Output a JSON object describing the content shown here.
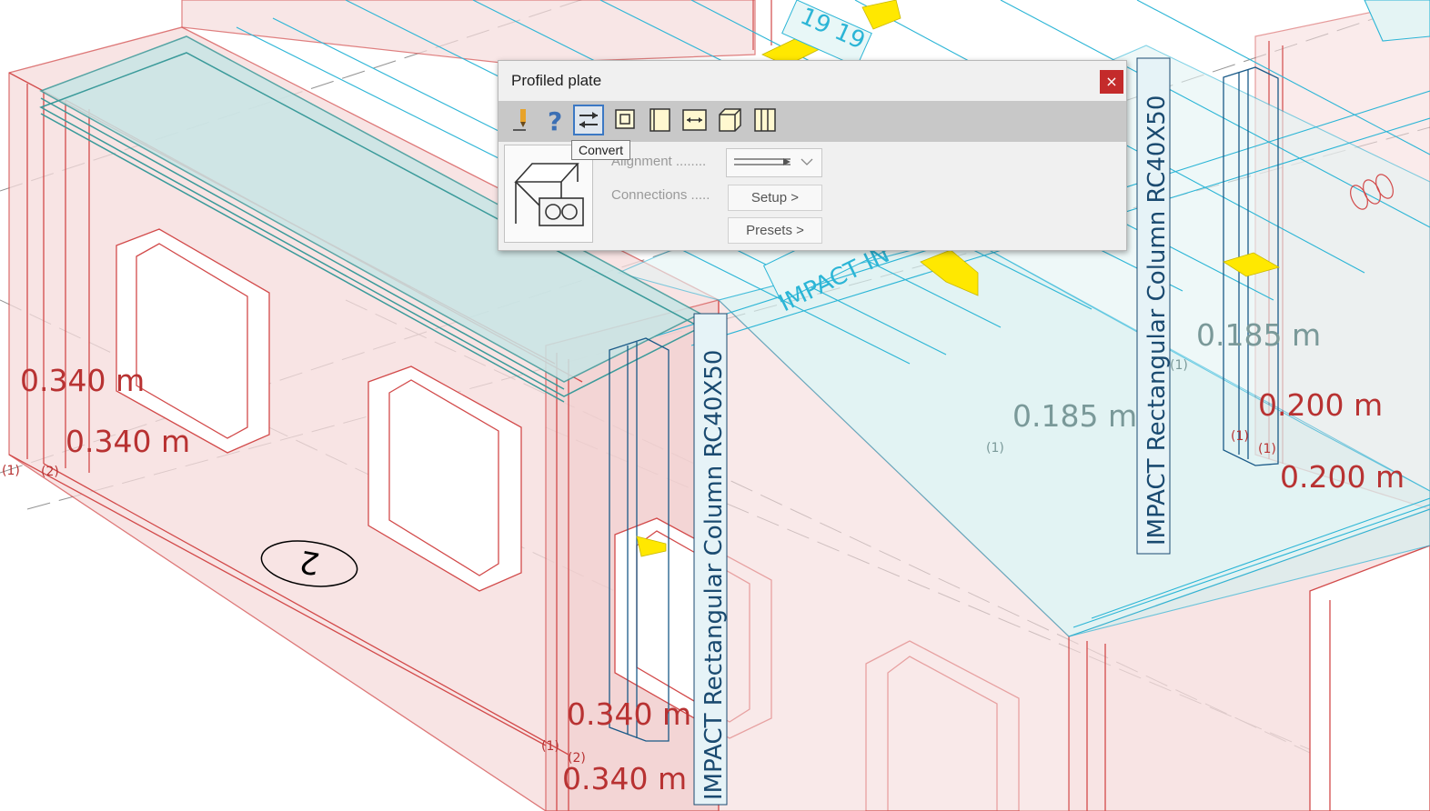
{
  "dialog": {
    "title": "Profiled plate",
    "close_label": "×",
    "tooltip": "Convert",
    "alignment_label": "Alignment ........",
    "connections_label": "Connections .....",
    "setup_button": "Setup >",
    "presets_button": "Presets >",
    "toolbar_icons": [
      "pencil-icon",
      "help-icon",
      "convert-icon",
      "square-frame-icon",
      "panel-icon",
      "width-icon",
      "box-icon",
      "columns-icon"
    ]
  },
  "model": {
    "dim_wall_1": "0.340 m",
    "dim_wall_2": "0.340 m",
    "dim_wall_3": "0.340 m",
    "dim_wall_4": "0.340 m",
    "dim_slab_1": "0.185 m",
    "dim_slab_2": "0.185 m",
    "dim_right_1": "0.200 m",
    "dim_right_2": "0.200 m",
    "column_label_1": "IMPACT Rectangular Column RC40X50",
    "column_label_2": "IMPACT Rectangular Column RC40X50",
    "beam_label": "IMPACT IN",
    "beam_tag": "19 19",
    "grid_marker": "2",
    "ref_1": "(1)",
    "ref_2": "(2)"
  },
  "colors": {
    "wall_fill": "#f6dcdc",
    "wall_line": "#d24a4a",
    "structure_line": "#2bb5d6",
    "slab_fill": "#d7eeee",
    "highlight": "#ffe800",
    "dim_red": "#b83232",
    "dim_grey": "#7a9999",
    "label_blue": "#1a4a70",
    "close_red": "#c42b2b"
  }
}
